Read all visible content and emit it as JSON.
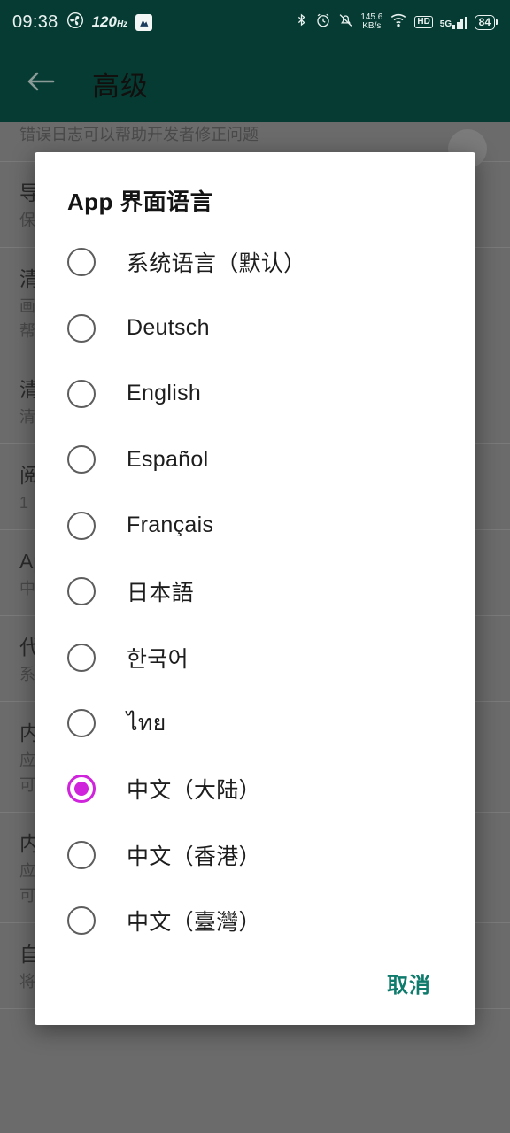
{
  "status_bar": {
    "clock": "09:38",
    "refresh_rate": "120",
    "refresh_rate_unit": "Hz",
    "net_speed_value": "145.6",
    "net_speed_unit": "KB/s",
    "hd_label": "HD",
    "network_type": "5G",
    "battery_percent": "84",
    "icons": [
      "fan-icon",
      "app-badge-icon",
      "bluetooth-icon",
      "alarm-icon",
      "mute-bell-icon",
      "wifi-icon",
      "signal-bars-icon",
      "battery-icon"
    ]
  },
  "app_bar": {
    "title": "高级",
    "back_icon": "arrow-left-icon"
  },
  "background_list": {
    "rows": [
      {
        "title": "",
        "subtitle": "错误日志可以帮助开发者修正问题",
        "has_toggle": true
      },
      {
        "title": "导出日志",
        "subtitle": "保存日志到文件",
        "has_toggle": false
      },
      {
        "title": "清除缓存",
        "subtitle": "画面缓存会占用存储空间",
        "subtitle2": "帮助释放空间",
        "has_toggle": false
      },
      {
        "title": "清除数据",
        "subtitle": "清除全部应用数据",
        "has_toggle": false
      },
      {
        "title": "阅读模式",
        "subtitle": "1",
        "has_toggle": false
      },
      {
        "title": "App 界面语言",
        "subtitle": "中文（大陆）",
        "has_toggle": false
      },
      {
        "title": "代理设置",
        "subtitle": "系统代理配置",
        "has_toggle": false
      },
      {
        "title": "内置规则",
        "subtitle": "应用内置的规则列表",
        "subtitle2": "可被自定义规则覆盖",
        "has_toggle": false
      },
      {
        "title": "内置 hosts",
        "subtitle": "应用内置的 hosts 列表",
        "subtitle2": "可被自定义 hosts.txt 覆盖",
        "has_toggle": false
      },
      {
        "title": "自定义 hosts.txt",
        "subtitle": "将主机名称映射到相应的IP地址",
        "has_toggle": false
      }
    ]
  },
  "dialog": {
    "title": "App 界面语言",
    "selected_index": 8,
    "options": [
      {
        "label": "系统语言（默认）",
        "selected": false
      },
      {
        "label": "Deutsch",
        "selected": false
      },
      {
        "label": "English",
        "selected": false
      },
      {
        "label": "Español",
        "selected": false
      },
      {
        "label": "Français",
        "selected": false
      },
      {
        "label": "日本語",
        "selected": false
      },
      {
        "label": "한국어",
        "selected": false
      },
      {
        "label": "ไทย",
        "selected": false
      },
      {
        "label": "中文（大陆）",
        "selected": true
      },
      {
        "label": "中文（香港）",
        "selected": false
      },
      {
        "label": "中文（臺灣）",
        "selected": false
      }
    ],
    "cancel_label": "取消",
    "accent_color": "#cf23dc",
    "action_color": "#0f7b6c"
  },
  "colors": {
    "app_bar_bg": "#063b33",
    "status_bar_bg": "#063b33",
    "dim_overlay": "#6b6b6b",
    "dialog_bg": "#ffffff",
    "radio_selected": "#cf23dc",
    "cancel_text": "#0f7b6c"
  }
}
